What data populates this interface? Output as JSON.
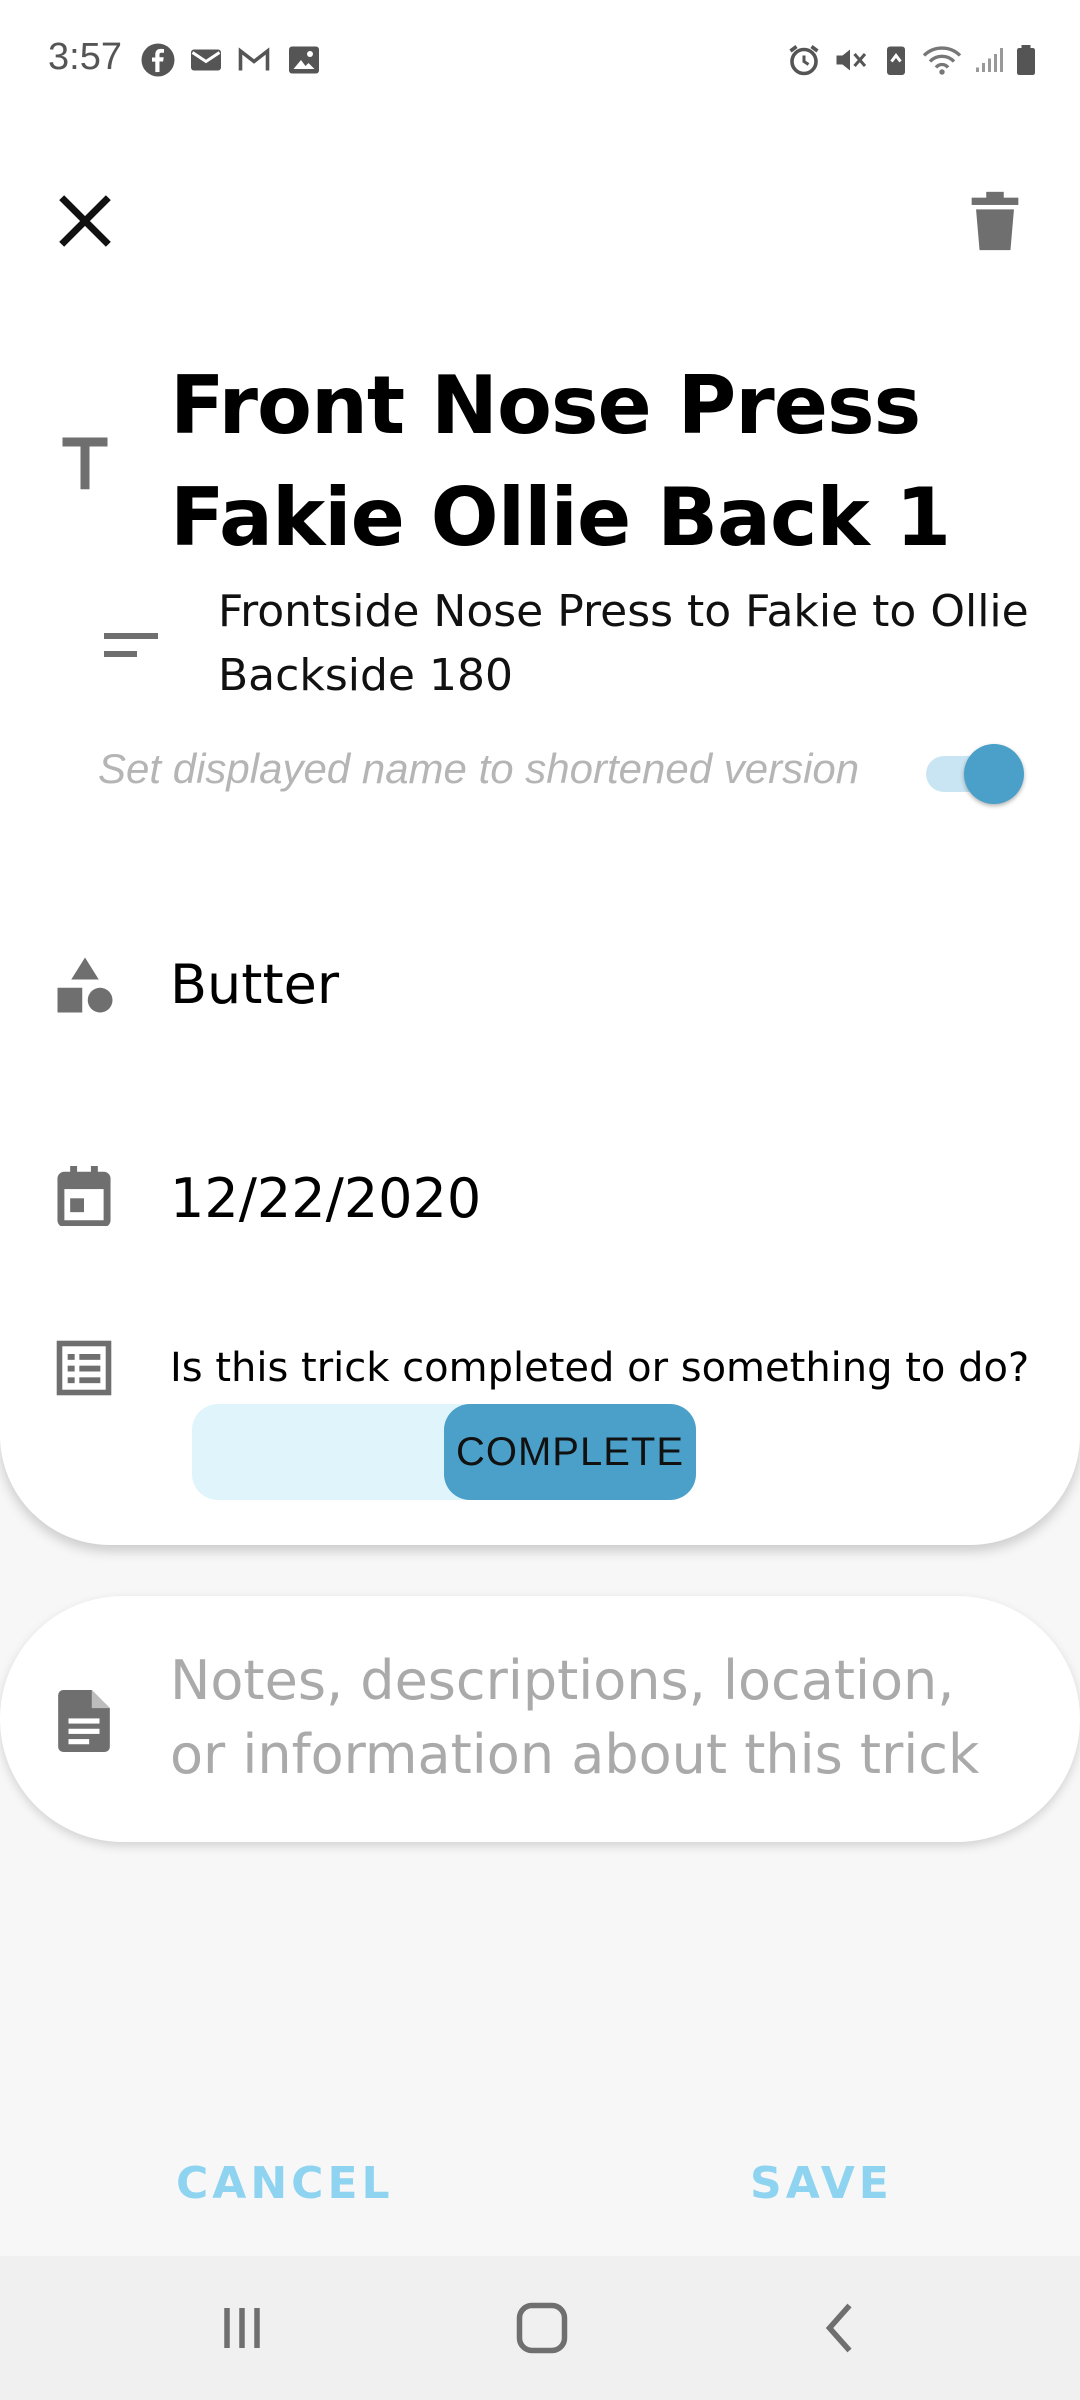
{
  "status_bar": {
    "time": "3:57",
    "left_icons": [
      "facebook-icon",
      "mail-icon",
      "gmail-icon",
      "gallery-icon"
    ],
    "right_icons": [
      "alarm-icon",
      "mute-icon",
      "battery-saver-icon",
      "wifi-icon",
      "signal-icon",
      "battery-icon"
    ]
  },
  "header": {
    "close_icon": "close-icon",
    "delete_icon": "trash-icon"
  },
  "trick": {
    "title": "Front Nose Press Fakie Ollie Back 1",
    "full_name": "Frontside Nose Press to Fakie to Ollie Backside 180",
    "shorten_label": "Set displayed name to shortened version",
    "shorten_enabled": true,
    "category": "Butter",
    "date": "12/22/2020",
    "status_question": "Is this trick completed or something to do?",
    "status_selected": "COMPLETE"
  },
  "notes": {
    "placeholder": "Notes, descriptions, location, or information about this trick"
  },
  "actions": {
    "cancel_label": "CANCEL",
    "save_label": "SAVE"
  },
  "colors": {
    "accent": "#4aa0c9",
    "accent_light": "#e0f4fc",
    "action_text": "#8ed3f0",
    "icon_gray": "#6f6f6f"
  }
}
